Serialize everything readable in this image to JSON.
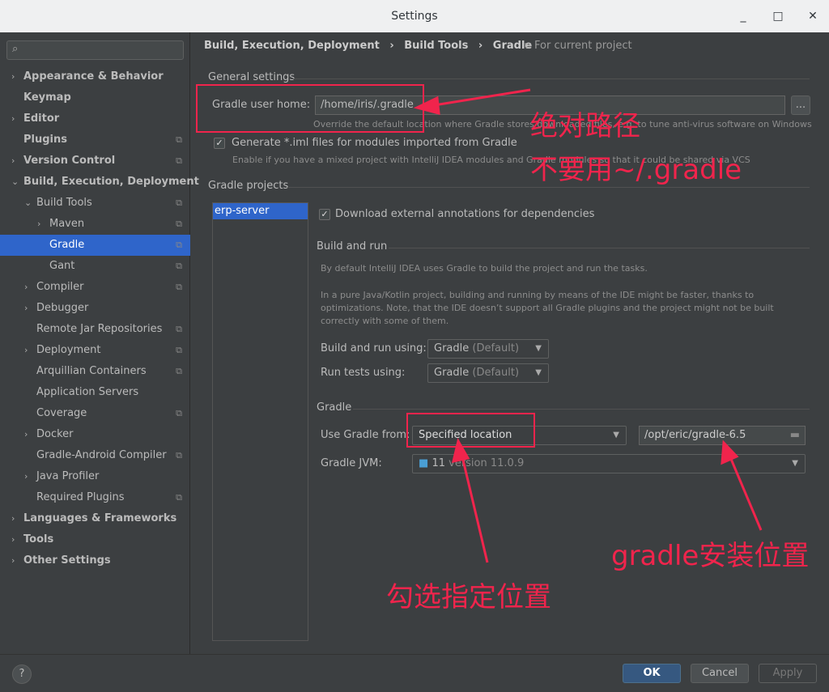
{
  "window": {
    "title": "Settings",
    "minimize": "_",
    "maximize": "□",
    "close": "✕"
  },
  "search": {
    "placeholder": ""
  },
  "sidebar": {
    "items": [
      {
        "label": "Appearance & Behavior",
        "arrow": "›",
        "bold": true
      },
      {
        "label": "Keymap",
        "bold": true
      },
      {
        "label": "Editor",
        "arrow": "›",
        "bold": true
      },
      {
        "label": "Plugins",
        "bold": true,
        "copy": true
      },
      {
        "label": "Version Control",
        "arrow": "›",
        "bold": true,
        "copy": true
      },
      {
        "label": "Build, Execution, Deployment",
        "arrow": "⌄",
        "bold": true
      },
      {
        "label": "Build Tools",
        "arrow": "⌄",
        "copy": true
      },
      {
        "label": "Maven",
        "arrow": "›",
        "copy": true
      },
      {
        "label": "Gradle",
        "copy": true,
        "selected": true
      },
      {
        "label": "Gant",
        "copy": true
      },
      {
        "label": "Compiler",
        "arrow": "›",
        "copy": true
      },
      {
        "label": "Debugger",
        "arrow": "›"
      },
      {
        "label": "Remote Jar Repositories",
        "copy": true
      },
      {
        "label": "Deployment",
        "arrow": "›",
        "copy": true
      },
      {
        "label": "Arquillian Containers",
        "copy": true
      },
      {
        "label": "Application Servers"
      },
      {
        "label": "Coverage",
        "copy": true
      },
      {
        "label": "Docker",
        "arrow": "›"
      },
      {
        "label": "Gradle-Android Compiler",
        "copy": true
      },
      {
        "label": "Java Profiler",
        "arrow": "›"
      },
      {
        "label": "Required Plugins",
        "copy": true
      },
      {
        "label": "Languages & Frameworks",
        "arrow": "›",
        "bold": true
      },
      {
        "label": "Tools",
        "arrow": "›",
        "bold": true
      },
      {
        "label": "Other Settings",
        "arrow": "›",
        "bold": true
      }
    ]
  },
  "breadcrumb": {
    "items": [
      "Build, Execution, Deployment",
      "Build Tools",
      "Gradle"
    ],
    "sep": "›",
    "scope": "For current project"
  },
  "general": {
    "title": "General settings",
    "user_home_label": "Gradle user home:",
    "user_home_value": "/home/iris/.gradle",
    "browse": "...",
    "user_home_hint": "Override the default location where Gradle stores downloaded files, e.g. to tune anti-virus software on Windows",
    "generate_iml_label": "Generate *.iml files for modules imported from Gradle",
    "generate_iml_hint": "Enable if you have a mixed project with IntelliJ IDEA modules and Gradle modules so that it could be shared via VCS"
  },
  "projects": {
    "title": "Gradle projects",
    "list": [
      "erp-server"
    ],
    "download_annotations": "Download external annotations for dependencies",
    "build_run_title": "Build and run",
    "hint1": "By default IntelliJ IDEA uses Gradle to build the project and run the tasks.",
    "hint2": "In a pure Java/Kotlin project, building and running by means of the IDE might be faster, thanks to optimizations. Note, that the IDE doesn’t support all Gradle plugins and the project might not be built correctly with some of them.",
    "build_run_label": "Build and run using:",
    "build_run_value": "Gradle",
    "build_run_suffix": "(Default)",
    "run_tests_label": "Run tests using:",
    "run_tests_value": "Gradle",
    "run_tests_suffix": "(Default)",
    "gradle_title": "Gradle",
    "use_from_label": "Use Gradle from:",
    "use_from_value": "Specified location",
    "location_value": "/opt/eric/gradle-6.5",
    "jvm_label": "Gradle JVM:",
    "jvm_value": "11",
    "jvm_suffix": "version 11.0.9"
  },
  "annotations": {
    "a1": "绝对路径",
    "a2": "不要用~/.gradle",
    "a3": "gradle安装位置",
    "a4": "勾选指定位置",
    "color": "#f0244c"
  },
  "footer": {
    "help": "?",
    "ok": "OK",
    "cancel": "Cancel",
    "apply": "Apply"
  }
}
